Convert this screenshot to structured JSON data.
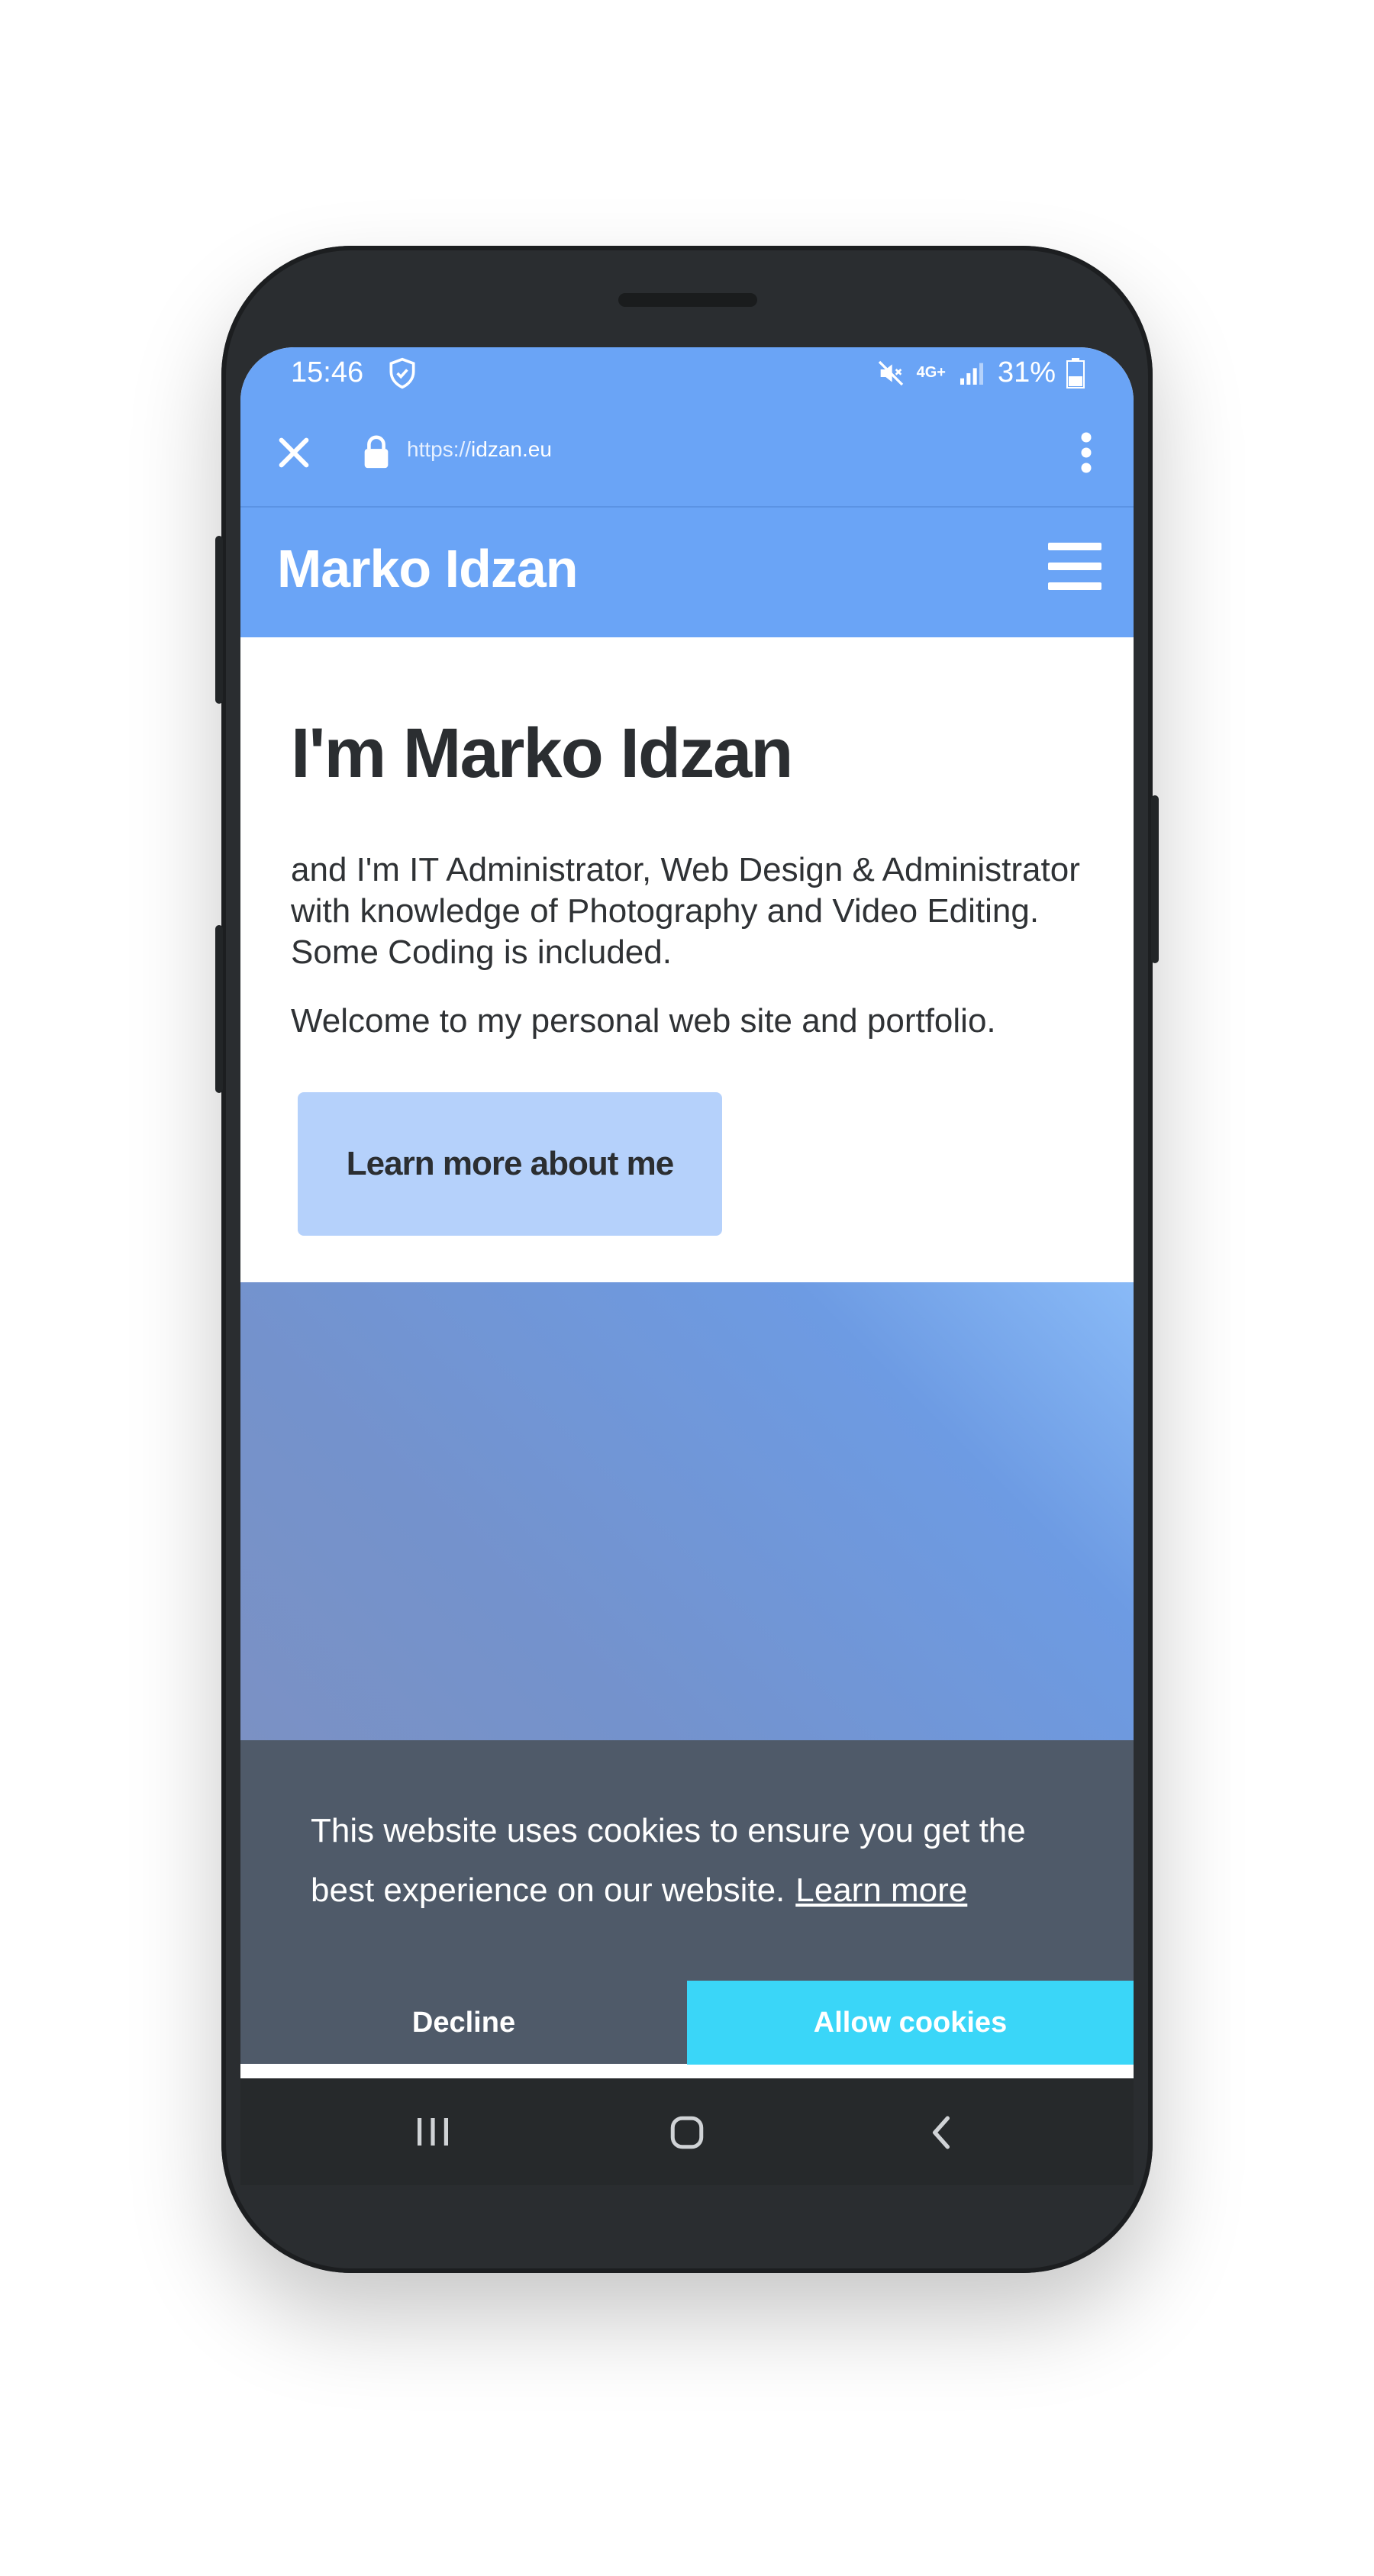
{
  "status_bar": {
    "time": "15:46",
    "network": "4G+",
    "battery": "31%"
  },
  "browser": {
    "url_scheme": "https://",
    "url_host": "idzan.eu"
  },
  "site": {
    "brand": "Marko Idzan",
    "heading": "I'm Marko Idzan",
    "intro": "and I'm IT Administrator, Web Design & Administrator with knowledge of Photography and Video Editing. Some Coding is included.",
    "welcome": "Welcome to my personal web site and portfolio.",
    "cta_label": "Learn more about me"
  },
  "cookie_banner": {
    "message": "This website uses cookies to ensure you get the best experience on our website.",
    "learn_more": "Learn more",
    "decline": "Decline",
    "allow": "Allow cookies"
  },
  "colors": {
    "accent": "#6aa4f6",
    "button_bg": "#b5d1fb",
    "cookie_bg": "#4f5a69",
    "allow_bg": "#3ad6f8"
  }
}
